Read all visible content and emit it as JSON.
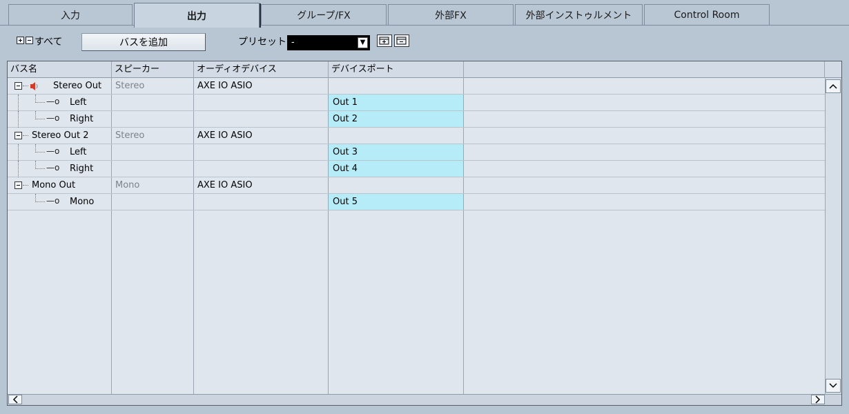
{
  "tabs": [
    {
      "label": "入力",
      "active": false
    },
    {
      "label": "出力",
      "active": true
    },
    {
      "label": "グループ/FX",
      "active": false
    },
    {
      "label": "外部FX",
      "active": false
    },
    {
      "label": "外部インストゥルメント",
      "active": false
    },
    {
      "label": "Control Room",
      "active": false
    }
  ],
  "toolbar": {
    "all_label": "すべて",
    "add_bus_label": "バスを追加",
    "preset_label": "プリセット",
    "preset_value": "-"
  },
  "columns": [
    "バス名",
    "スピーカー",
    "オーディオデバイス",
    "デバイスポート"
  ],
  "rows": [
    {
      "name": "Stereo Out",
      "speaker": "Stereo",
      "device": "AXE IO ASIO",
      "port": ""
    },
    {
      "name": "Left",
      "speaker": "",
      "device": "",
      "port": "Out 1"
    },
    {
      "name": "Right",
      "speaker": "",
      "device": "",
      "port": "Out 2"
    },
    {
      "name": "Stereo Out 2",
      "speaker": "Stereo",
      "device": "AXE IO ASIO",
      "port": ""
    },
    {
      "name": "Left",
      "speaker": "",
      "device": "",
      "port": "Out 3"
    },
    {
      "name": "Right",
      "speaker": "",
      "device": "",
      "port": "Out 4"
    },
    {
      "name": "Mono Out",
      "speaker": "Mono",
      "device": "AXE IO ASIO",
      "port": ""
    },
    {
      "name": "Mono",
      "speaker": "",
      "device": "",
      "port": "Out 5"
    }
  ],
  "colors": {
    "background": "#b8c5d3",
    "grid_bg": "#dfe6ee",
    "port_highlight": "#b6ecf8",
    "speaker_icon": "#d23a2a"
  },
  "icons": [
    "expand-all-icon",
    "collapse-all-icon",
    "speaker-icon",
    "port-connector-icon",
    "preset-save-icon",
    "preset-delete-icon",
    "scroll-up-icon",
    "scroll-down-icon",
    "scroll-left-icon",
    "scroll-right-icon"
  ]
}
